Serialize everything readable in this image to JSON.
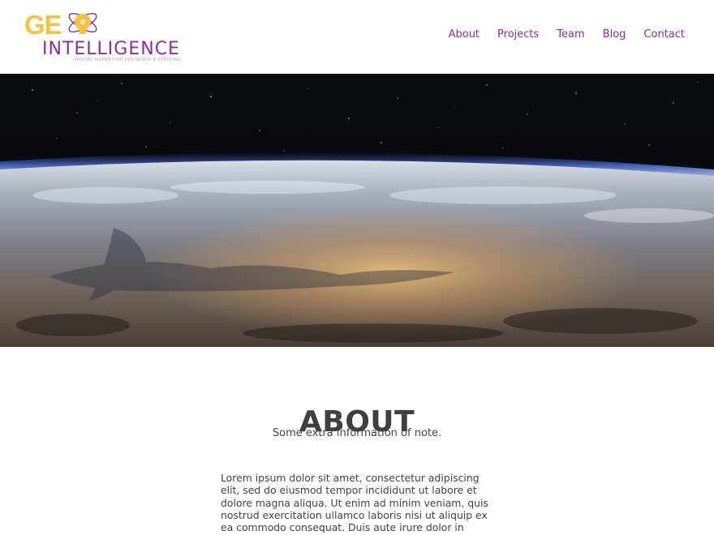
{
  "logo": {
    "part1": "GE",
    "part2": "INTELLIGENCE",
    "tagline": "DIGITAL MARKETING PRESENCE & STAFFING"
  },
  "nav": {
    "items": [
      {
        "label": "About"
      },
      {
        "label": "Projects"
      },
      {
        "label": "Team"
      },
      {
        "label": "Blog"
      },
      {
        "label": "Contact"
      }
    ]
  },
  "colors": {
    "brand_purple": "#8e2f95",
    "brand_yellow": "#f5c242",
    "heading": "#3f3f3f",
    "body_text": "#444444"
  },
  "hero": {
    "image": "earth-from-orbit-with-starfield"
  },
  "about": {
    "title": "ABOUT",
    "subtitle": "Some extra information of note.",
    "body": "Lorem ipsum dolor sit amet, consectetur adipiscing elit, sed do eiusmod tempor incididunt ut labore et dolore magna aliqua. Ut enim ad minim veniam, quis nostrud exercitation ullamco laboris nisi ut aliquip ex ea commodo consequat. Duis aute irure dolor in reprehenderit in"
  }
}
